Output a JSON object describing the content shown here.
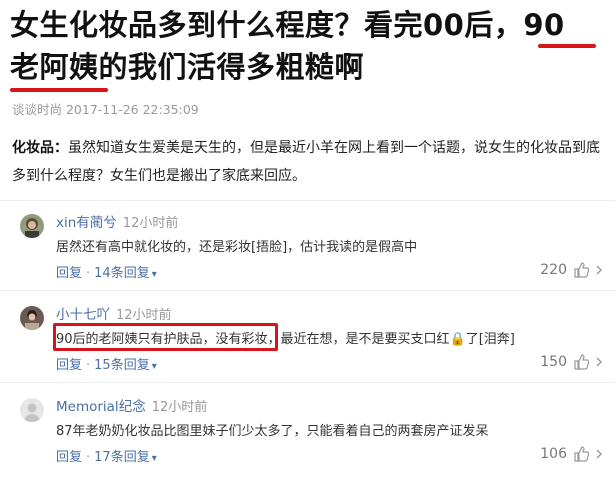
{
  "article": {
    "title_part1": "女生化妆品多到什么程度？看完00后，",
    "title_underlined1": "90",
    "title_underlined2": "老阿姨",
    "title_part2": "的我们活得多粗糙啊",
    "meta": "谈谈时尚 2017-11-26 22:35:09",
    "intro_label": "化妆品：",
    "intro_text": "虽然知道女生爱美是天生的，但是最近小羊在网上看到一个话题，说女生的化妆品到底多到什么程度？女生们也是搬出了家底来回应。"
  },
  "comments": [
    {
      "author": "xin有蔺兮",
      "time": "12小时前",
      "text": "居然还有高中就化妆的，还是彩妆[捂脸]，估计我读的是假高中",
      "reply_label": "回复",
      "replies": "14条回复",
      "likes": "220",
      "avatar_color": "#7b8a6e"
    },
    {
      "author": "小十七吖",
      "time": "12小时前",
      "text_highlight": "90后的老阿姨只有护肤品，没有彩妆",
      "text_rest": "，最近在想，是不是要买支口红🔒了[泪奔]",
      "reply_label": "回复",
      "replies": "15条回复",
      "likes": "150",
      "avatar_color": "#6b5a52"
    },
    {
      "author": "Memorial纪",
      "author_suffix": "念",
      "time": "12小时前",
      "text": "87年老奶奶化妆品比图里妹子们少太多了，只能看着自己的两套房产证发呆",
      "reply_label": "回复",
      "replies": "17条回复",
      "likes": "106",
      "avatar_color": "#e3e3e3"
    }
  ],
  "colors": {
    "accent": "#d8141b",
    "link": "#4a6fa5"
  }
}
